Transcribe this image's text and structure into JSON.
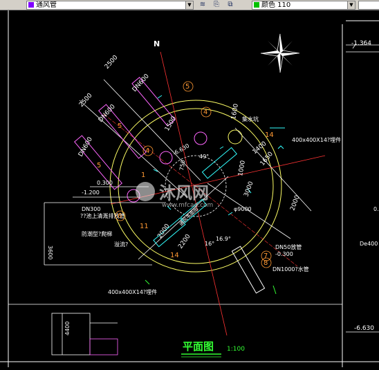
{
  "toolbar": {
    "layer_label": "通风管",
    "layer_color": "#8000ff",
    "color_label": "颜色 110",
    "color_swatch": "#00c000"
  },
  "drawing": {
    "north": "N",
    "elev_right": "-1.364",
    "elev_right2": "-6.630",
    "dim_top_a": "2500",
    "dim_top_b": "2500",
    "dn600_a": "DN600",
    "dn600_b": "DN600",
    "dn600_c": "DN600",
    "d1600": "1600",
    "d1500": "1500",
    "d1400": "1400",
    "d1000": "1000",
    "d1650": "1650",
    "sump": "集水坑",
    "beam_top": "400x400X14?埋件",
    "elev_650": "-6.630",
    "angle_49": "49°",
    "angle_16": "16°",
    "angle_16_9": "16.9°",
    "dim_3000": "3000",
    "dim_2000": "2000",
    "dim_2000b": "2000",
    "dim_phi9000": "φ9000",
    "dim_2200": "2200",
    "dim_750": "750",
    "elev_0300": "0.300",
    "elev_m1200": "-1.200",
    "dn300": "DN300",
    "pipe_outlet": "??池上清溉排放管",
    "waterproof": "防潮型?爬梯",
    "dim_3600": "3600",
    "overflow": "溢流?",
    "pipe_center": "通风平面图",
    "dn50": "DN50放管",
    "elev_m0300": "-0.300",
    "dn1000": "DN1000?水管",
    "beam_bottom": "400x400X14?埋件",
    "de400": "De400",
    "dim_0": "0.",
    "label_1": "1",
    "label_4a": "4",
    "label_4b": "4",
    "label_5a": "5",
    "label_5b": "5",
    "label_5c": "5",
    "label_6": "6",
    "label_7": "7",
    "label_8": "8",
    "label_11": "11",
    "label_14a": "14",
    "label_14b": "14",
    "dim_4400": "4400",
    "plan_title": "平面图",
    "plan_scale": "1:100",
    "watermark_text": "沐风网",
    "watermark_url": "www.mfcad.com"
  }
}
